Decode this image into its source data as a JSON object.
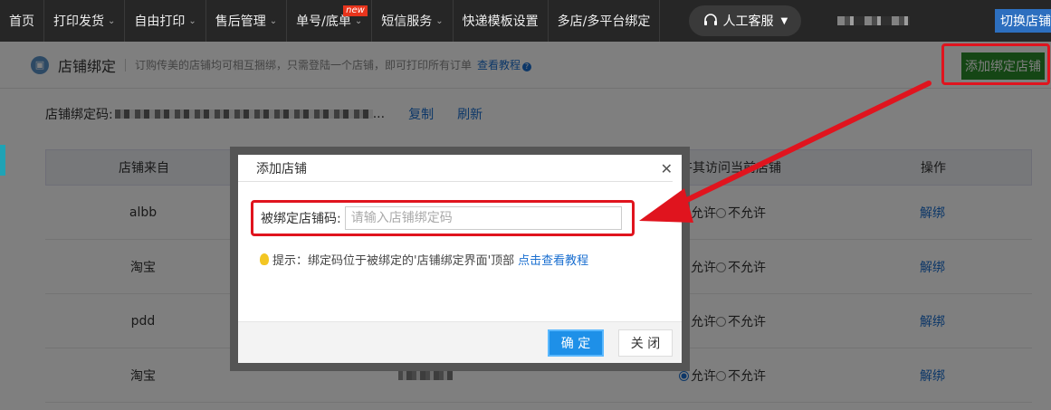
{
  "nav": {
    "items": [
      {
        "label": "首页",
        "chevron": false
      },
      {
        "label": "打印发货",
        "chevron": true
      },
      {
        "label": "自由打印",
        "chevron": true
      },
      {
        "label": "售后管理",
        "chevron": true
      },
      {
        "label": "单号/底单",
        "chevron": true,
        "badge": "new"
      },
      {
        "label": "短信服务",
        "chevron": true
      },
      {
        "label": "快递模板设置",
        "chevron": false
      },
      {
        "label": "多店/多平台绑定",
        "chevron": false
      }
    ],
    "service_label": "人工客服",
    "switch_shop_label": "切换店铺"
  },
  "header": {
    "title": "店铺绑定",
    "description": "订购传美的店铺均可相互捆绑，只需登陆一个店铺，即可打印所有订单",
    "tutorial_link": "查看教程",
    "add_button": "添加绑定店铺"
  },
  "bind_code": {
    "label": "店铺绑定码:",
    "suffix": "...",
    "copy_label": "复制",
    "refresh_label": "刷新"
  },
  "table": {
    "columns": [
      "店铺来自",
      "许其访问当前店铺",
      "操作"
    ],
    "rows": [
      {
        "source": "albb",
        "allow": "允许",
        "deny": "不允许",
        "action": "解绑"
      },
      {
        "source": "淘宝",
        "allow": "允许",
        "deny": "不允许",
        "action": "解绑"
      },
      {
        "source": "pdd",
        "allow": "允许",
        "deny": "不允许",
        "action": "解绑"
      },
      {
        "source": "淘宝",
        "allow": "允许",
        "deny": "不允许",
        "action": "解绑"
      }
    ]
  },
  "dialog": {
    "title": "添加店铺",
    "field_label": "被绑定店铺码:",
    "field_placeholder": "请输入店铺绑定码",
    "field_value": "",
    "tip_prefix": "提示：绑定码位于被绑定的'店铺绑定界面'顶部",
    "tip_link": "点击查看教程",
    "ok_label": "确 定",
    "close_label": "关 闭"
  },
  "colors": {
    "nav_bg": "#262626",
    "add_button": "#2a8c2a",
    "link": "#1a6fd0",
    "annotation": "#e0141e",
    "ok_button": "#1e90e8"
  }
}
